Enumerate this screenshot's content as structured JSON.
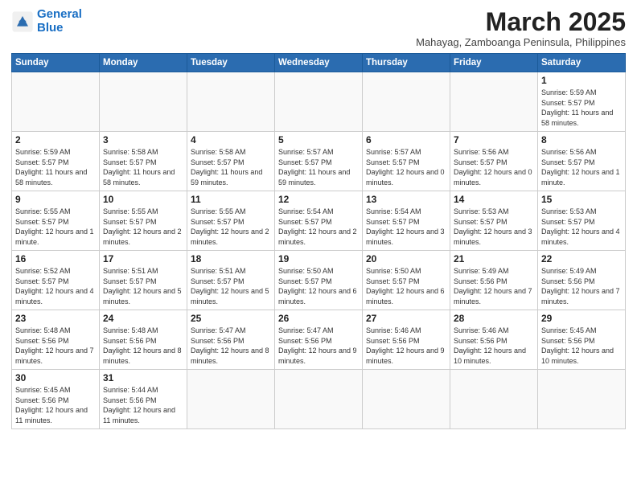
{
  "header": {
    "logo_general": "General",
    "logo_blue": "Blue",
    "title": "March 2025",
    "subtitle": "Mahayag, Zamboanga Peninsula, Philippines"
  },
  "weekdays": [
    "Sunday",
    "Monday",
    "Tuesday",
    "Wednesday",
    "Thursday",
    "Friday",
    "Saturday"
  ],
  "days": [
    {
      "num": "",
      "sunrise": "",
      "sunset": "",
      "daylight": "",
      "empty": true
    },
    {
      "num": "",
      "sunrise": "",
      "sunset": "",
      "daylight": "",
      "empty": true
    },
    {
      "num": "",
      "sunrise": "",
      "sunset": "",
      "daylight": "",
      "empty": true
    },
    {
      "num": "",
      "sunrise": "",
      "sunset": "",
      "daylight": "",
      "empty": true
    },
    {
      "num": "",
      "sunrise": "",
      "sunset": "",
      "daylight": "",
      "empty": true
    },
    {
      "num": "",
      "sunrise": "",
      "sunset": "",
      "daylight": "",
      "empty": true
    },
    {
      "num": "1",
      "sunrise": "Sunrise: 5:59 AM",
      "sunset": "Sunset: 5:57 PM",
      "daylight": "Daylight: 11 hours and 58 minutes.",
      "empty": false
    },
    {
      "num": "2",
      "sunrise": "Sunrise: 5:59 AM",
      "sunset": "Sunset: 5:57 PM",
      "daylight": "Daylight: 11 hours and 58 minutes.",
      "empty": false
    },
    {
      "num": "3",
      "sunrise": "Sunrise: 5:58 AM",
      "sunset": "Sunset: 5:57 PM",
      "daylight": "Daylight: 11 hours and 58 minutes.",
      "empty": false
    },
    {
      "num": "4",
      "sunrise": "Sunrise: 5:58 AM",
      "sunset": "Sunset: 5:57 PM",
      "daylight": "Daylight: 11 hours and 59 minutes.",
      "empty": false
    },
    {
      "num": "5",
      "sunrise": "Sunrise: 5:57 AM",
      "sunset": "Sunset: 5:57 PM",
      "daylight": "Daylight: 11 hours and 59 minutes.",
      "empty": false
    },
    {
      "num": "6",
      "sunrise": "Sunrise: 5:57 AM",
      "sunset": "Sunset: 5:57 PM",
      "daylight": "Daylight: 12 hours and 0 minutes.",
      "empty": false
    },
    {
      "num": "7",
      "sunrise": "Sunrise: 5:56 AM",
      "sunset": "Sunset: 5:57 PM",
      "daylight": "Daylight: 12 hours and 0 minutes.",
      "empty": false
    },
    {
      "num": "8",
      "sunrise": "Sunrise: 5:56 AM",
      "sunset": "Sunset: 5:57 PM",
      "daylight": "Daylight: 12 hours and 1 minute.",
      "empty": false
    },
    {
      "num": "9",
      "sunrise": "Sunrise: 5:55 AM",
      "sunset": "Sunset: 5:57 PM",
      "daylight": "Daylight: 12 hours and 1 minute.",
      "empty": false
    },
    {
      "num": "10",
      "sunrise": "Sunrise: 5:55 AM",
      "sunset": "Sunset: 5:57 PM",
      "daylight": "Daylight: 12 hours and 2 minutes.",
      "empty": false
    },
    {
      "num": "11",
      "sunrise": "Sunrise: 5:55 AM",
      "sunset": "Sunset: 5:57 PM",
      "daylight": "Daylight: 12 hours and 2 minutes.",
      "empty": false
    },
    {
      "num": "12",
      "sunrise": "Sunrise: 5:54 AM",
      "sunset": "Sunset: 5:57 PM",
      "daylight": "Daylight: 12 hours and 2 minutes.",
      "empty": false
    },
    {
      "num": "13",
      "sunrise": "Sunrise: 5:54 AM",
      "sunset": "Sunset: 5:57 PM",
      "daylight": "Daylight: 12 hours and 3 minutes.",
      "empty": false
    },
    {
      "num": "14",
      "sunrise": "Sunrise: 5:53 AM",
      "sunset": "Sunset: 5:57 PM",
      "daylight": "Daylight: 12 hours and 3 minutes.",
      "empty": false
    },
    {
      "num": "15",
      "sunrise": "Sunrise: 5:53 AM",
      "sunset": "Sunset: 5:57 PM",
      "daylight": "Daylight: 12 hours and 4 minutes.",
      "empty": false
    },
    {
      "num": "16",
      "sunrise": "Sunrise: 5:52 AM",
      "sunset": "Sunset: 5:57 PM",
      "daylight": "Daylight: 12 hours and 4 minutes.",
      "empty": false
    },
    {
      "num": "17",
      "sunrise": "Sunrise: 5:51 AM",
      "sunset": "Sunset: 5:57 PM",
      "daylight": "Daylight: 12 hours and 5 minutes.",
      "empty": false
    },
    {
      "num": "18",
      "sunrise": "Sunrise: 5:51 AM",
      "sunset": "Sunset: 5:57 PM",
      "daylight": "Daylight: 12 hours and 5 minutes.",
      "empty": false
    },
    {
      "num": "19",
      "sunrise": "Sunrise: 5:50 AM",
      "sunset": "Sunset: 5:57 PM",
      "daylight": "Daylight: 12 hours and 6 minutes.",
      "empty": false
    },
    {
      "num": "20",
      "sunrise": "Sunrise: 5:50 AM",
      "sunset": "Sunset: 5:57 PM",
      "daylight": "Daylight: 12 hours and 6 minutes.",
      "empty": false
    },
    {
      "num": "21",
      "sunrise": "Sunrise: 5:49 AM",
      "sunset": "Sunset: 5:56 PM",
      "daylight": "Daylight: 12 hours and 7 minutes.",
      "empty": false
    },
    {
      "num": "22",
      "sunrise": "Sunrise: 5:49 AM",
      "sunset": "Sunset: 5:56 PM",
      "daylight": "Daylight: 12 hours and 7 minutes.",
      "empty": false
    },
    {
      "num": "23",
      "sunrise": "Sunrise: 5:48 AM",
      "sunset": "Sunset: 5:56 PM",
      "daylight": "Daylight: 12 hours and 7 minutes.",
      "empty": false
    },
    {
      "num": "24",
      "sunrise": "Sunrise: 5:48 AM",
      "sunset": "Sunset: 5:56 PM",
      "daylight": "Daylight: 12 hours and 8 minutes.",
      "empty": false
    },
    {
      "num": "25",
      "sunrise": "Sunrise: 5:47 AM",
      "sunset": "Sunset: 5:56 PM",
      "daylight": "Daylight: 12 hours and 8 minutes.",
      "empty": false
    },
    {
      "num": "26",
      "sunrise": "Sunrise: 5:47 AM",
      "sunset": "Sunset: 5:56 PM",
      "daylight": "Daylight: 12 hours and 9 minutes.",
      "empty": false
    },
    {
      "num": "27",
      "sunrise": "Sunrise: 5:46 AM",
      "sunset": "Sunset: 5:56 PM",
      "daylight": "Daylight: 12 hours and 9 minutes.",
      "empty": false
    },
    {
      "num": "28",
      "sunrise": "Sunrise: 5:46 AM",
      "sunset": "Sunset: 5:56 PM",
      "daylight": "Daylight: 12 hours and 10 minutes.",
      "empty": false
    },
    {
      "num": "29",
      "sunrise": "Sunrise: 5:45 AM",
      "sunset": "Sunset: 5:56 PM",
      "daylight": "Daylight: 12 hours and 10 minutes.",
      "empty": false
    },
    {
      "num": "30",
      "sunrise": "Sunrise: 5:45 AM",
      "sunset": "Sunset: 5:56 PM",
      "daylight": "Daylight: 12 hours and 11 minutes.",
      "empty": false
    },
    {
      "num": "31",
      "sunrise": "Sunrise: 5:44 AM",
      "sunset": "Sunset: 5:56 PM",
      "daylight": "Daylight: 12 hours and 11 minutes.",
      "empty": false
    },
    {
      "num": "",
      "sunrise": "",
      "sunset": "",
      "daylight": "",
      "empty": true
    },
    {
      "num": "",
      "sunrise": "",
      "sunset": "",
      "daylight": "",
      "empty": true
    },
    {
      "num": "",
      "sunrise": "",
      "sunset": "",
      "daylight": "",
      "empty": true
    },
    {
      "num": "",
      "sunrise": "",
      "sunset": "",
      "daylight": "",
      "empty": true
    },
    {
      "num": "",
      "sunrise": "",
      "sunset": "",
      "daylight": "",
      "empty": true
    }
  ]
}
